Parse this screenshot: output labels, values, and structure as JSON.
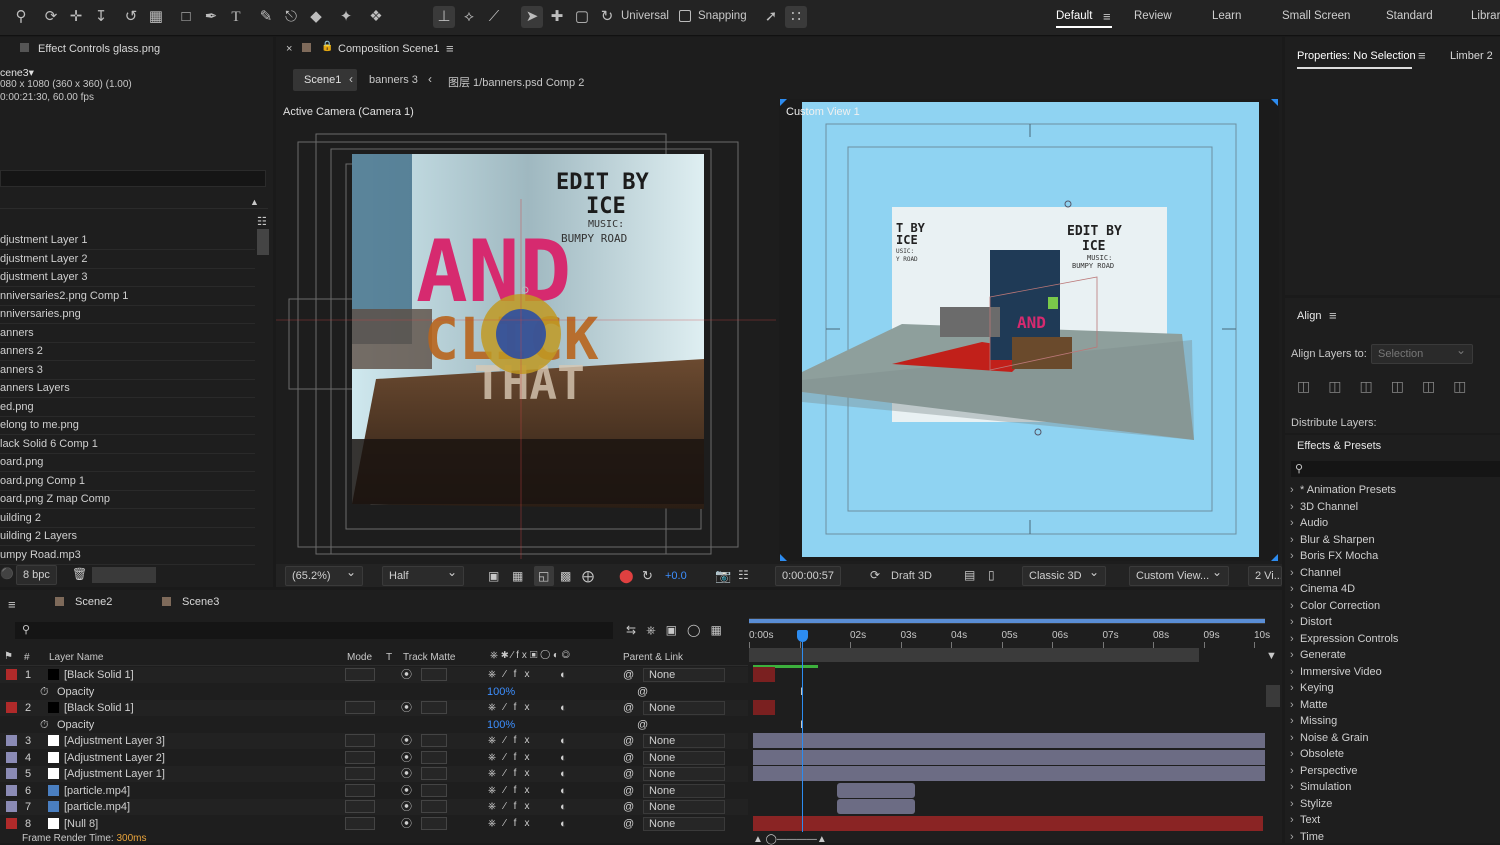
{
  "toolbar": {
    "snapping_label": "Snapping",
    "universal_label": "Universal",
    "workspaces": [
      "Default",
      "Review",
      "Learn",
      "Small Screen",
      "Standard",
      "Librar"
    ]
  },
  "project": {
    "effect_controls_tab": "Effect Controls glass.png",
    "comp_name": "cene3▾",
    "comp_size": "080 x 1080  (360 x 360) (1.00)",
    "comp_duration": "0:00:21:30, 60.00 fps",
    "items": [
      "djustment Layer 1",
      "djustment Layer 2",
      "djustment Layer 3",
      "nniversaries2.png Comp 1",
      "nniversaries.png",
      "anners",
      "anners 2",
      "anners 3",
      "anners Layers",
      "ed.png",
      "elong to me.png",
      "lack Solid 6 Comp 1",
      "oard.png",
      "oard.png Comp 1",
      "oard.png Z map Comp",
      "uilding 2",
      "uilding 2 Layers",
      "umpy Road.mp3"
    ],
    "bpc_label": "8 bpc"
  },
  "composition": {
    "tab_label": "Composition Scene1",
    "breadcrumbs": [
      "Scene1",
      "banners 3",
      "图层 1/banners.psd Comp 2"
    ],
    "left_view_label": "Active Camera (Camera 1)",
    "right_view_label": "Custom View 1",
    "poster_text": {
      "edit_by": "EDIT BY",
      "ice": "ICE",
      "music": "MUSIC:",
      "bumpy": "BUMPY ROAD",
      "and": "AND",
      "click": "CLICK",
      "that": "THAT"
    },
    "room_text": {
      "left_line1": "T BY",
      "left_line2": "ICE",
      "left_line3": "USIC:",
      "left_line4": "Y ROAD",
      "right_line1": "EDIT BY",
      "right_line2": "ICE",
      "right_line3": "MUSIC:",
      "right_line4": "BUMPY ROAD",
      "red_text": "AND"
    },
    "zoom": "(65.2%)",
    "resolution": "Half",
    "exposure": "+0.0",
    "timecode": "0:00:00:57",
    "renderer_draft": "Draft 3D",
    "renderer": "Classic 3D",
    "view_mode": "Custom View...",
    "view_layout": "2 Vi..."
  },
  "properties": {
    "tab_label": "Properties: No Selection",
    "tab2_label": "Limber 2"
  },
  "align": {
    "title": "Align",
    "align_to_label": "Align Layers to:",
    "align_to_value": "Selection",
    "distribute_label": "Distribute Layers:"
  },
  "effects": {
    "title": "Effects & Presets",
    "items": [
      "* Animation Presets",
      "3D Channel",
      "Audio",
      "Blur & Sharpen",
      "Boris FX Mocha",
      "Channel",
      "Cinema 4D",
      "Color Correction",
      "Distort",
      "Expression Controls",
      "Generate",
      "Immersive Video",
      "Keying",
      "Matte",
      "Missing",
      "Noise & Grain",
      "Obsolete",
      "Perspective",
      "Simulation",
      "Stylize",
      "Text",
      "Time"
    ]
  },
  "timeline": {
    "tabs": [
      "Scene2",
      "Scene3"
    ],
    "columns": {
      "num": "#",
      "layer_name": "Layer Name",
      "mode": "Mode",
      "t": "T",
      "track_matte": "Track Matte",
      "parent": "Parent & Link"
    },
    "ruler": [
      "0:00s",
      "",
      "02s",
      "03s",
      "04s",
      "05s",
      "06s",
      "07s",
      "08s",
      "09s",
      "10s"
    ],
    "rows": [
      {
        "num": "1",
        "name": "[Black Solid 1]",
        "parent": "None",
        "label_color": "#b02a2a",
        "swatch": "#000000"
      },
      {
        "num": "",
        "name": "Opacity",
        "value": "100%"
      },
      {
        "num": "2",
        "name": "[Black Solid 1]",
        "parent": "None",
        "label_color": "#b02a2a",
        "swatch": "#000000"
      },
      {
        "num": "",
        "name": "Opacity",
        "value": "100%"
      },
      {
        "num": "3",
        "name": "[Adjustment Layer 3]",
        "parent": "None",
        "label_color": "#8b8bb5",
        "swatch": "#ffffff"
      },
      {
        "num": "4",
        "name": "[Adjustment Layer 2]",
        "parent": "None",
        "label_color": "#8b8bb5",
        "swatch": "#ffffff"
      },
      {
        "num": "5",
        "name": "[Adjustment Layer 1]",
        "parent": "None",
        "label_color": "#8b8bb5",
        "swatch": "#ffffff"
      },
      {
        "num": "6",
        "name": "[particle.mp4]",
        "parent": "None",
        "label_color": "#8b8bb5",
        "swatch": "#4a7fc1"
      },
      {
        "num": "7",
        "name": "[particle.mp4]",
        "parent": "None",
        "label_color": "#8b8bb5",
        "swatch": "#4a7fc1"
      },
      {
        "num": "8",
        "name": "[Null 8]",
        "parent": "None",
        "label_color": "#b02a2a",
        "swatch": "#ffffff"
      }
    ],
    "render_time_label": "Frame Render Time:",
    "render_time_value": "300ms"
  },
  "colors": {
    "accent": "#2d8cf0",
    "red_label": "#b02a2a",
    "purple_label": "#8b8bb5",
    "sky": "#8fd3f2"
  }
}
